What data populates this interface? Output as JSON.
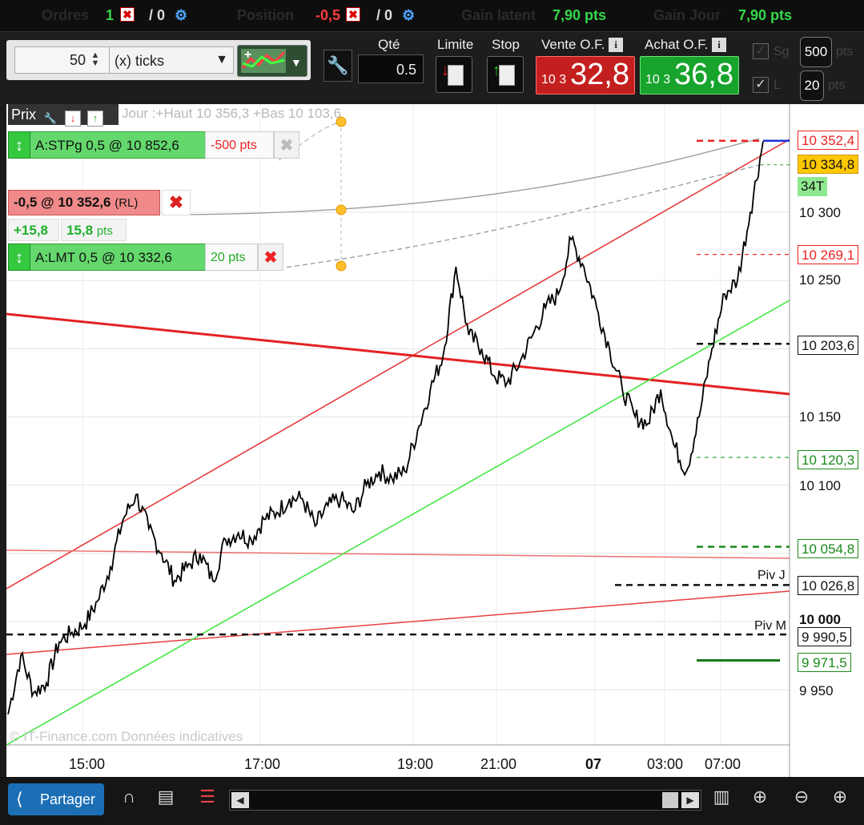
{
  "status_bar": {
    "orders_label": "Ordres",
    "orders_count": "1",
    "orders_slash": "/ 0",
    "position_label": "Position",
    "position_value": "-0,5",
    "position_slash": "/ 0",
    "gain_latent_label": "Gain latent",
    "gain_latent_value": "7,90 pts",
    "gain_jour_label": "Gain Jour",
    "gain_jour_value": "7,90 pts"
  },
  "toolbar": {
    "ticks_value": "50",
    "ticks_unit": "(x) ticks",
    "qty_label": "Qté",
    "qty_value": "0.5",
    "limit_label": "Limite",
    "stop_label": "Stop",
    "sell_label": "Vente O.F.",
    "sell_price_small": "10 3",
    "sell_price_big": "32,8",
    "buy_label": "Achat O.F.",
    "buy_price_small": "10 3",
    "buy_price_big": "36,8",
    "sg_label": "Sg",
    "l_label": "L",
    "pts_top": "500",
    "pts_bottom": "20",
    "pts_unit": "pts"
  },
  "chart_header": {
    "prix_label": "Prix",
    "day_info": "Jour :+Haut 10 356,3 +Bas 10 103,6"
  },
  "orders": {
    "stop": {
      "label": "A:STPg  0,5 @ 10 852,6",
      "pts": "-500 pts"
    },
    "position": {
      "label": "-0,5 @ 10 352,6",
      "suffix": "(RL)"
    },
    "pnl": {
      "value": "+15,8",
      "pts_value": "15,8",
      "pts_unit": "pts"
    },
    "limit": {
      "label": "A:LMT  0,5 @ 10 332,6",
      "pts": "20 pts"
    }
  },
  "axis": {
    "y_ticks": [
      "10 300",
      "10 250",
      "10 150",
      "10 100",
      "10 000",
      "9 950"
    ],
    "x_ticks": [
      "15:00",
      "17:00",
      "19:00",
      "21:00",
      "07",
      "03:00",
      "07:00"
    ],
    "tags": {
      "stop_level": "10 352,4",
      "last_price": "10 334,8",
      "ticks_count": "34T",
      "r1": "10 269,1",
      "r2": "10 203,6",
      "s1": "10 120,3",
      "s2": "10 054,8",
      "piv_j_value": "10 026,8",
      "piv_m_value": "9 990,5",
      "s3": "9 971,5"
    },
    "piv_j_label": "Piv J",
    "piv_m_label": "Piv M"
  },
  "watermark": "© IT-Finance.com  Données indicatives",
  "bottom_bar": {
    "share_label": "Partager"
  },
  "colors": {
    "up": "#35d84a",
    "down": "#ff3b3b",
    "sell_bg": "#c41f1f",
    "buy_bg": "#17a32c",
    "price_line": "#000000",
    "resistance": "#e52020",
    "support": "#39e639",
    "pivot": "#000000"
  },
  "chart_data": {
    "type": "line",
    "title": "",
    "xlabel": "",
    "ylabel": "",
    "ylim": [
      9895,
      10390
    ],
    "grid": true,
    "x": [
      "13:40",
      "14:00",
      "14:20",
      "14:40",
      "15:00",
      "15:20",
      "15:40",
      "16:00",
      "16:10",
      "16:20",
      "16:40",
      "17:00",
      "17:20",
      "17:40",
      "18:00",
      "18:20",
      "18:40",
      "19:00",
      "19:20",
      "19:40",
      "20:00",
      "20:20",
      "20:40",
      "21:00",
      "21:20",
      "21:40",
      "22:00",
      "22:10",
      "22:20",
      "22:40",
      "23:00",
      "23:20",
      "23:40",
      "00:00",
      "00:20",
      "00:40",
      "01:00",
      "01:20",
      "01:40",
      "02:00",
      "02:20",
      "02:40",
      "03:00",
      "03:20",
      "03:40",
      "04:00",
      "04:20",
      "04:40",
      "05:00",
      "05:10",
      "05:30",
      "05:50",
      "06:10",
      "06:30",
      "06:50",
      "07:10",
      "07:30",
      "07:50",
      "08:10",
      "08:20"
    ],
    "series": [
      {
        "values": [
          9932,
          9975,
          9948,
          9955,
          9985,
          9992,
          9998,
          10015,
          10040,
          10075,
          10093,
          10068,
          10050,
          10030,
          10040,
          10050,
          10030,
          10060,
          10065,
          10060,
          10075,
          10080,
          10090,
          10090,
          10070,
          10085,
          10090,
          10080,
          10100,
          10110,
          10105,
          10110,
          10140,
          10170,
          10195,
          10260,
          10210,
          10200,
          10180,
          10175,
          10190,
          10210,
          10230,
          10240,
          10280,
          10260,
          10230,
          10200,
          10170,
          10150,
          10145,
          10170,
          10130,
          10110,
          10150,
          10200,
          10240,
          10250,
          10300,
          10352
        ]
      }
    ],
    "levels": [
      {
        "label": "10 352,4",
        "value": 10352.4
      },
      {
        "label": "10 334,8",
        "value": 10334.8
      },
      {
        "label": "10 269,1",
        "value": 10269.1
      },
      {
        "label": "10 203,6",
        "value": 10203.6
      },
      {
        "label": "10 120,3",
        "value": 10120.3
      },
      {
        "label": "10 054,8",
        "value": 10054.8
      },
      {
        "label": "Piv J",
        "value": 10026.8
      },
      {
        "label": "Piv M",
        "value": 9990.5
      },
      {
        "label": "9 971,5",
        "value": 9971.5
      }
    ]
  }
}
